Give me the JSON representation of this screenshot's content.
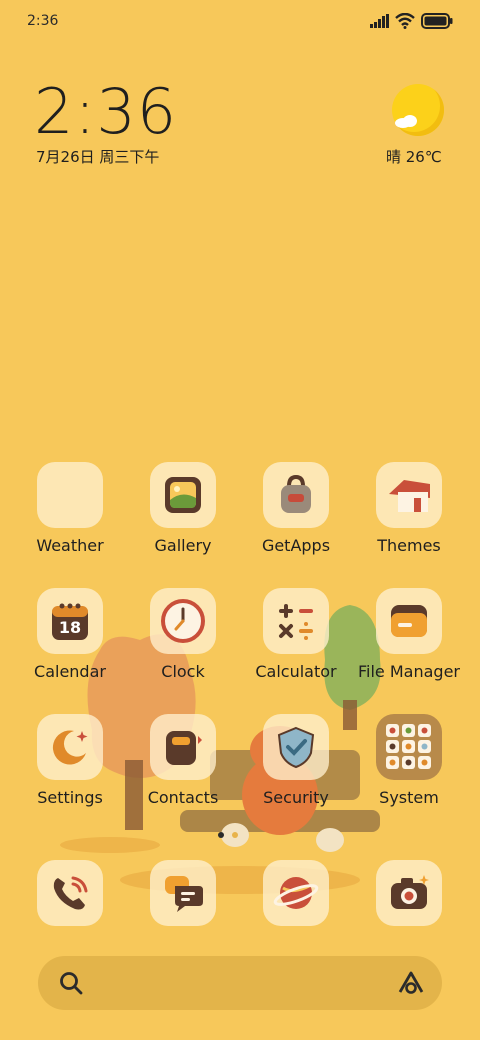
{
  "status": {
    "time": "2:36"
  },
  "lock_widget": {
    "time": "2:36",
    "date": "7月26日 周三下午",
    "weather": "晴 26℃"
  },
  "apps": {
    "weather": "Weather",
    "gallery": "Gallery",
    "getapps": "GetApps",
    "themes": "Themes",
    "calendar": "Calendar",
    "calendar_day": "18",
    "clock": "Clock",
    "calculator": "Calculator",
    "filemanager": "File Manager",
    "settings": "Settings",
    "contacts": "Contacts",
    "security": "Security",
    "system": "System"
  },
  "dock": [
    "phone-icon",
    "messages-icon",
    "browser-icon",
    "camera-icon"
  ],
  "search": {
    "left_icon": "search-icon",
    "right_icon": "assistant-icon"
  },
  "colors": {
    "background": "#f7c85a",
    "tile": "#fff0cd",
    "search_bar": "#e3b44a"
  }
}
